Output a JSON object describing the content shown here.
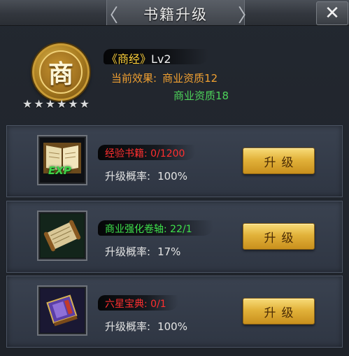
{
  "header": {
    "title": "书籍升级",
    "prev_arrow": "〈",
    "next_arrow": "〉",
    "close": "✕"
  },
  "book": {
    "emblem_char": "商",
    "stars": [
      "★",
      "★",
      "★",
      "★",
      "★",
      "★"
    ],
    "name": "《商经》",
    "level": "Lv2",
    "effect_label": "当前效果:",
    "current_effect": "商业资质12",
    "next_effect": "商业资质18"
  },
  "items": [
    {
      "icon": "exp-book-icon",
      "name": "经验书籍:",
      "count": "0/1200",
      "rate_label": "升级概率:",
      "rate": "100%",
      "button": "升级",
      "exp_text": "EXP",
      "color": "#ff2f2f"
    },
    {
      "icon": "scroll-icon",
      "name": "商业强化卷轴:",
      "count": "22/1",
      "rate_label": "升级概率:",
      "rate": "17%",
      "button": "升级",
      "color": "#3ee24b"
    },
    {
      "icon": "treasure-book-icon",
      "name": "六星宝典:",
      "count": "0/1",
      "rate_label": "升级概率:",
      "rate": "100%",
      "button": "升级",
      "color": "#ff2f2f"
    }
  ]
}
